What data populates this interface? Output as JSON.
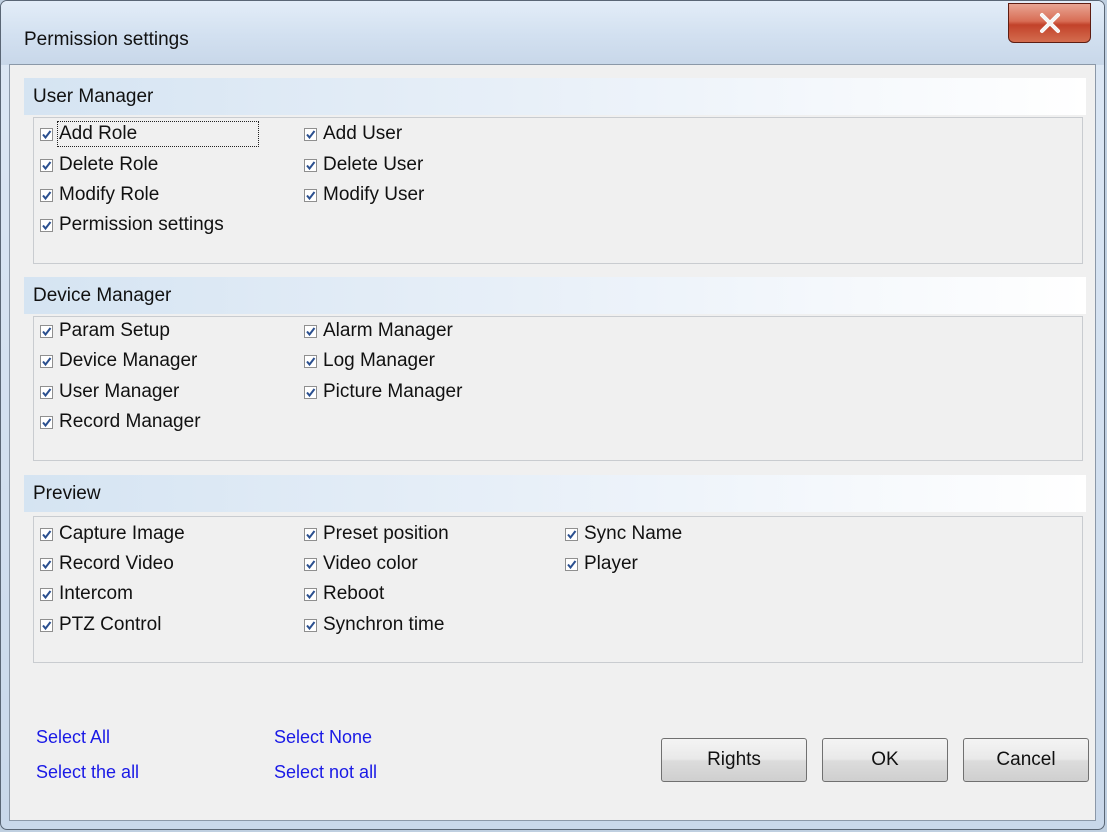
{
  "window": {
    "title": "Permission settings",
    "close_label": "X"
  },
  "groups": {
    "user_manager": {
      "title": "User Manager",
      "items": [
        "Add Role",
        "Add User",
        "Delete Role",
        "Delete User",
        "Modify Role",
        "Modify User",
        "Permission settings"
      ]
    },
    "device_manager": {
      "title": "Device Manager",
      "items": [
        "Param Setup",
        "Alarm Manager",
        "Device Manager",
        "Log Manager",
        "User Manager",
        "Picture Manager",
        "Record Manager"
      ]
    },
    "preview": {
      "title": "Preview",
      "items": [
        "Capture Image",
        "Preset position",
        "Sync Name",
        "Record Video",
        "Video color",
        "Player",
        "Intercom",
        "Reboot",
        "PTZ Control",
        "Synchron time"
      ]
    }
  },
  "all_checked": true,
  "links": {
    "select_all": "Select All",
    "select_none": "Select None",
    "select_the_all": "Select the all",
    "select_not_all": "Select not all"
  },
  "buttons": {
    "rights": "Rights",
    "ok": "OK",
    "cancel": "Cancel"
  }
}
